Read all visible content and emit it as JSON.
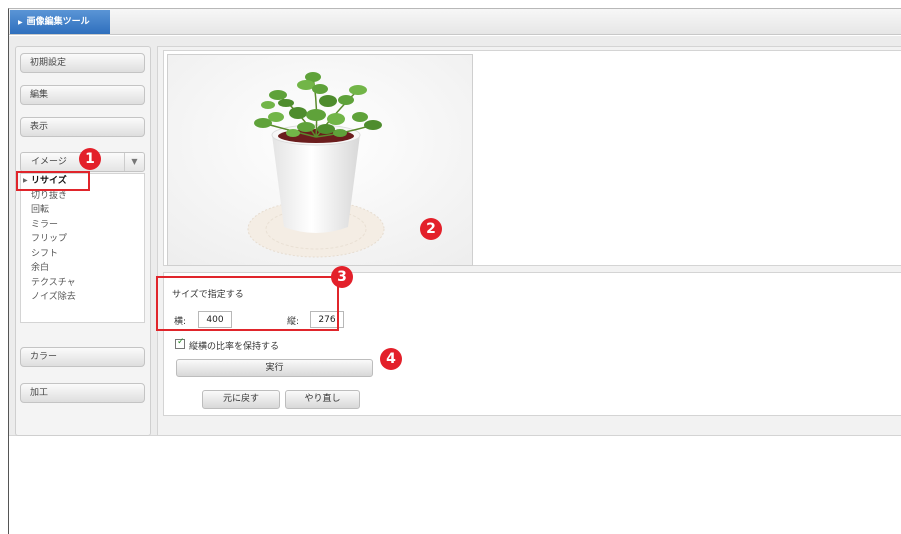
{
  "window": {
    "title": "画像編集ツール"
  },
  "sidebar": {
    "buttons": [
      {
        "label": "初期設定"
      },
      {
        "label": "編集"
      },
      {
        "label": "表示"
      }
    ],
    "image_dropdown": {
      "selected": "イメージ"
    },
    "image_items": [
      {
        "label": "リサイズ",
        "selected": true
      },
      {
        "label": "切り抜き"
      },
      {
        "label": "回転"
      },
      {
        "label": "ミラー"
      },
      {
        "label": "フリップ"
      },
      {
        "label": "シフト"
      },
      {
        "label": "余白"
      },
      {
        "label": "テクスチャ"
      },
      {
        "label": "ノイズ除去"
      }
    ],
    "lower_buttons": [
      {
        "label": "カラー"
      },
      {
        "label": "加工"
      }
    ]
  },
  "resize_panel": {
    "heading": "サイズで指定する",
    "width_label": "横:",
    "width_value": "400",
    "height_label": "縦:",
    "height_value": "276",
    "keep_ratio_label": "縦横の比率を保持する",
    "keep_ratio_checked": true,
    "execute_label": "実行",
    "undo_label": "元に戻す",
    "redo_label": "やり直し"
  },
  "annotations": {
    "badge_1": "1",
    "badge_2": "2",
    "badge_3": "3",
    "badge_4": "4"
  },
  "colors": {
    "title_tab": "#2f6fbd",
    "callout_red": "#e0252b",
    "checkbox_tick": "#2a8a2a"
  }
}
